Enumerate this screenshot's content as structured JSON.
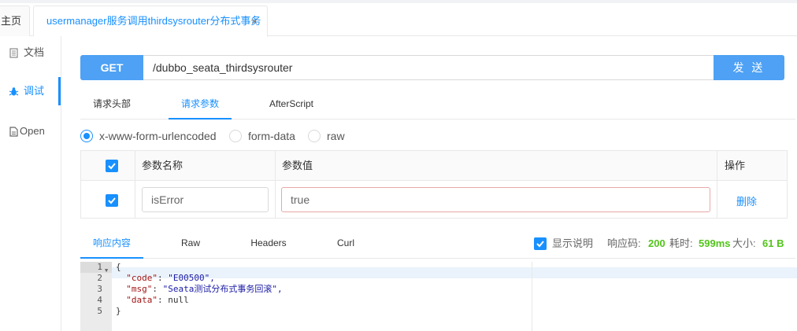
{
  "tabs": {
    "home_label": "主页",
    "active_label": "usermanager服务调用thirdsysrouter分布式事务",
    "close_glyph": "×"
  },
  "sidebar": {
    "items": [
      {
        "label": "文档",
        "icon": "document-icon"
      },
      {
        "label": "调试",
        "icon": "bug-icon"
      },
      {
        "label": "Open",
        "icon": "file-icon"
      }
    ]
  },
  "request": {
    "method": "GET",
    "url": "/dubbo_seata_thirdsysrouter",
    "send_label": "发 送",
    "tabs": [
      "请求头部",
      "请求参数",
      "AfterScript"
    ],
    "active_tab": "请求参数",
    "body_types": [
      "x-www-form-urlencoded",
      "form-data",
      "raw"
    ],
    "selected_body_type": "x-www-form-urlencoded"
  },
  "params": {
    "headers": {
      "name": "参数名称",
      "value": "参数值",
      "action": "操作"
    },
    "rows": [
      {
        "checked": true,
        "name": "isError",
        "value": "true",
        "action": "删除"
      }
    ]
  },
  "response": {
    "tabs": [
      "响应内容",
      "Raw",
      "Headers",
      "Curl"
    ],
    "active_tab": "响应内容",
    "show_desc_label": "显示说明",
    "status_label": "响应码:",
    "status_value": "200",
    "time_label": "耗时:",
    "time_value": "599ms",
    "size_label": "大小:",
    "size_value": "61 B",
    "code_lines": [
      {
        "no": "1",
        "text": "{"
      },
      {
        "no": "2",
        "key": "\"code\"",
        "value": "\"E00500\","
      },
      {
        "no": "3",
        "key": "\"msg\"",
        "value": "\"Seata测试分布式事务回滚\","
      },
      {
        "no": "4",
        "key": "\"data\"",
        "value": "null"
      },
      {
        "no": "5",
        "text": "}"
      }
    ]
  },
  "colors": {
    "accent": "#1890ff",
    "button": "#4ea1f4",
    "success": "#52c41a"
  }
}
